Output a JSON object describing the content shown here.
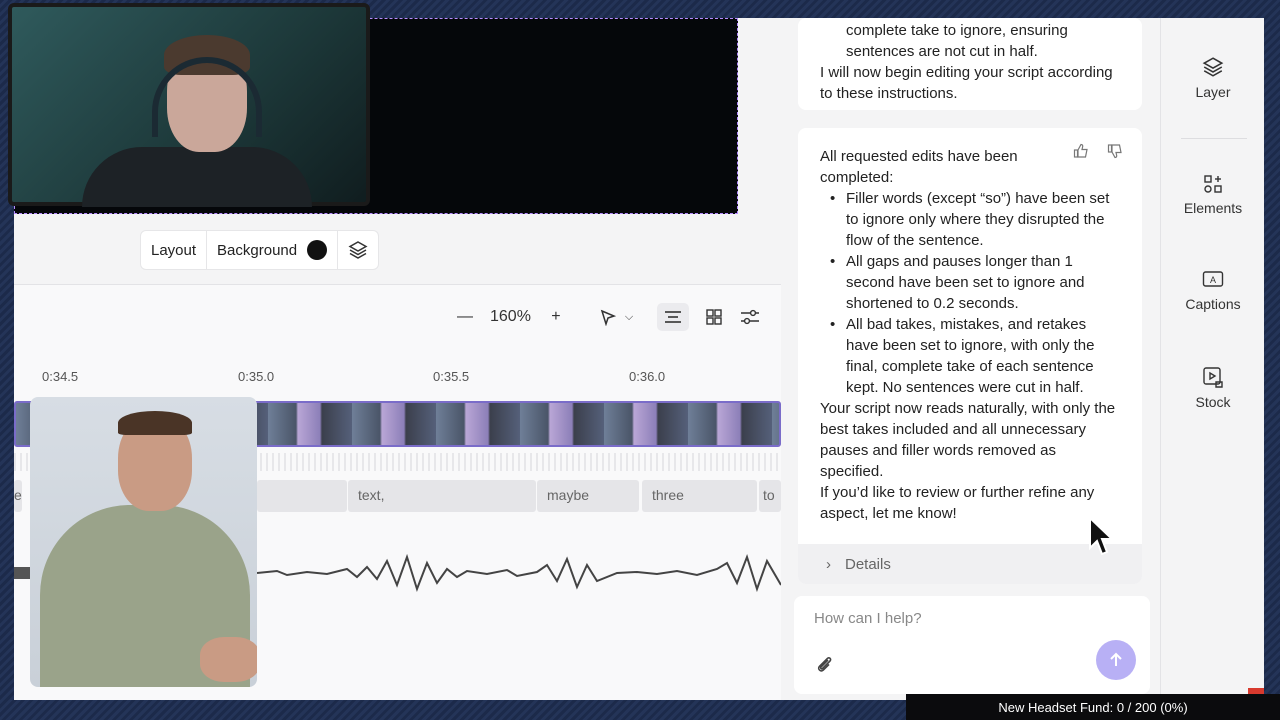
{
  "preview_toolbar": {
    "layout_label": "Layout",
    "background_label": "Background",
    "background_color": "#111111",
    "layers_icon": "layers-icon"
  },
  "timeline": {
    "zoom": "160%",
    "ruler": [
      "0:34.5",
      "0:35.0",
      "0:35.5",
      "0:36.0"
    ],
    "words": [
      "e",
      "text,",
      "maybe",
      "three",
      "to"
    ]
  },
  "chat": {
    "msg1": {
      "bullet_tail_1": "complete take to ignore, ensuring",
      "bullet_tail_2": "sentences are not cut in half.",
      "line": "I will now begin editing your script according to these instructions."
    },
    "msg2": {
      "intro": "All requested edits have been completed:",
      "bullets": [
        "Filler words (except “so”) have been set to ignore only where they disrupted the flow of the sentence.",
        "All gaps and pauses longer than 1 second have been set to ignore and shortened to 0.2 seconds.",
        "All bad takes, mistakes, and retakes have been set to ignore, with only the final, complete take of each sentence kept. No sentences were cut in half."
      ],
      "summary": "Your script now reads naturally, with only the best takes included and all unnecessary pauses and filler words removed as specified.",
      "closing": "If you’d like to review or further refine any aspect, let me know!",
      "details_label": "Details"
    },
    "input_placeholder": "How can I help?"
  },
  "sidebar": {
    "items": [
      {
        "label": "Layer",
        "icon": "layers-icon"
      },
      {
        "label": "Elements",
        "icon": "elements-icon"
      },
      {
        "label": "Captions",
        "icon": "captions-icon"
      },
      {
        "label": "Stock",
        "icon": "stock-icon"
      }
    ]
  },
  "ticker": {
    "text": "New Headset Fund: 0 / 200 (0%)",
    "progress": 0
  }
}
